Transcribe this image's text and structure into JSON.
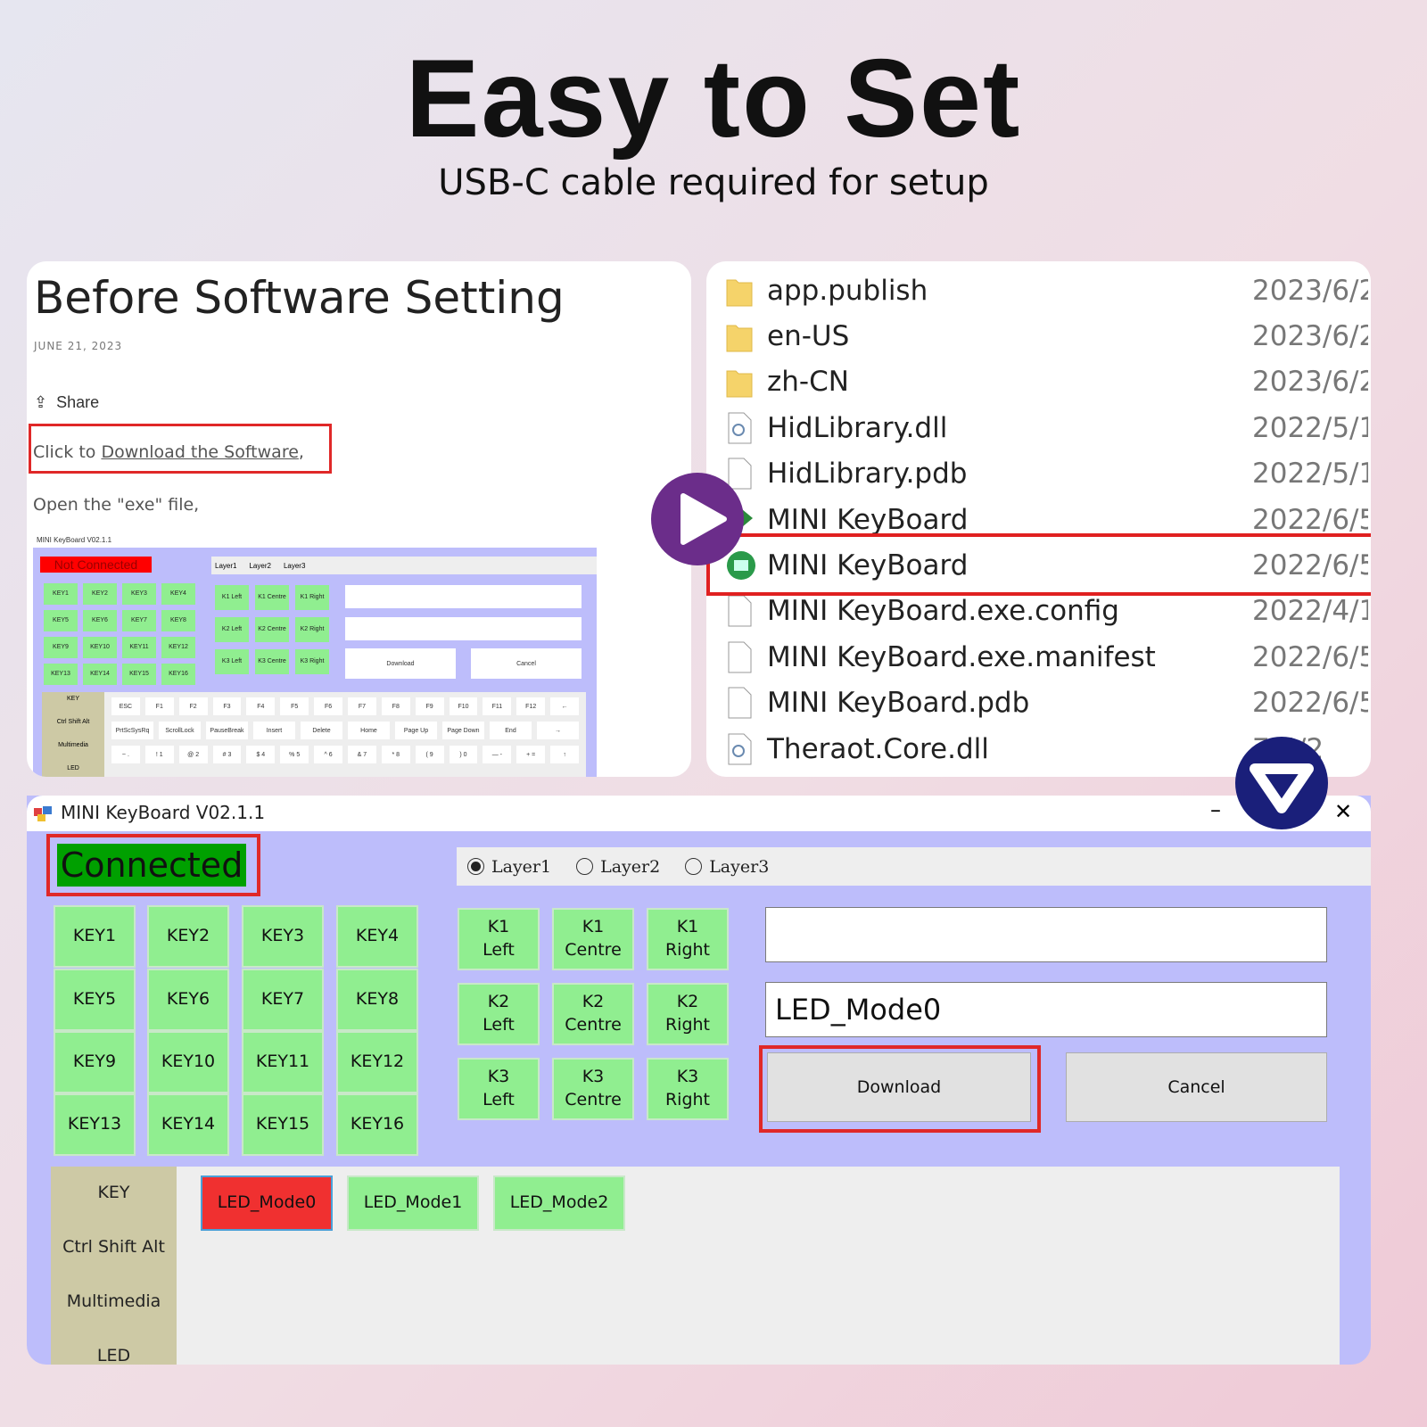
{
  "header": {
    "title": "Easy to Set",
    "subtitle": "USB-C cable required for setup"
  },
  "blog": {
    "title": "Before Software Setting",
    "date": "JUNE 21, 2023",
    "share": "Share",
    "click_to": "Click to ",
    "download_link": "Download the Software",
    "comma": ",",
    "open_exe": "Open the \"exe\" file,"
  },
  "mini_app": {
    "title": "MINI KeyBoard V02.1.1",
    "status": "Not Connected",
    "layers": [
      "Layer1",
      "Layer2",
      "Layer3"
    ],
    "keys": [
      "KEY1",
      "KEY2",
      "KEY3",
      "KEY4",
      "KEY5",
      "KEY6",
      "KEY7",
      "KEY8",
      "KEY9",
      "KEY10",
      "KEY11",
      "KEY12",
      "KEY13",
      "KEY14",
      "KEY15",
      "KEY16"
    ],
    "knobs": [
      "K1 Left",
      "K1 Centre",
      "K1 Right",
      "K2 Left",
      "K2 Centre",
      "K2 Right",
      "K3 Left",
      "K3 Centre",
      "K3 Right"
    ],
    "download": "Download",
    "cancel": "Cancel",
    "categories": [
      "KEY",
      "Ctrl Shift Alt",
      "Multimedia",
      "LED"
    ],
    "row1": [
      "ESC",
      "F1",
      "F2",
      "F3",
      "F4",
      "F5",
      "F6",
      "F7",
      "F8",
      "F9",
      "F10",
      "F11",
      "F12",
      "←"
    ],
    "row2": [
      "PrtScSysRq",
      "ScrollLock",
      "PauseBreak",
      "Insert",
      "Delete",
      "Home",
      "Page Up",
      "Page Down",
      "End",
      "→"
    ],
    "row3": [
      "~ .",
      "! 1",
      "@ 2",
      "# 3",
      "$ 4",
      "% 5",
      "^ 6",
      "& 7",
      "* 8",
      "( 9",
      ") 0",
      "— -",
      "+ =",
      "↑"
    ]
  },
  "files": [
    {
      "name": "app.publish",
      "date": "2023/6/2",
      "icon": "folder-icon"
    },
    {
      "name": "en-US",
      "date": "2023/6/2",
      "icon": "folder-icon"
    },
    {
      "name": "zh-CN",
      "date": "2023/6/2",
      "icon": "folder-icon"
    },
    {
      "name": "HidLibrary.dll",
      "date": "2022/5/1",
      "icon": "dll-icon"
    },
    {
      "name": "HidLibrary.pdb",
      "date": "2022/5/1",
      "icon": "file-icon"
    },
    {
      "name": "MINI KeyBoard",
      "date": "2022/6/5",
      "icon": "shortcut-icon"
    },
    {
      "name": "MINI KeyBoard",
      "date": "2022/6/5",
      "icon": "app-icon",
      "highlighted": true
    },
    {
      "name": "MINI KeyBoard.exe.config",
      "date": "2022/4/1",
      "icon": "file-icon"
    },
    {
      "name": "MINI KeyBoard.exe.manifest",
      "date": "2022/6/5",
      "icon": "file-icon"
    },
    {
      "name": "MINI KeyBoard.pdb",
      "date": "2022/6/5",
      "icon": "file-icon"
    },
    {
      "name": "Theraot.Core.dll",
      "date": "7/4/2",
      "icon": "dll-icon"
    }
  ],
  "app": {
    "title": "MINI KeyBoard V02.1.1",
    "minimize": "–",
    "close": "✕",
    "status": "Connected",
    "layers": [
      "Layer1",
      "Layer2",
      "Layer3"
    ],
    "selected_layer": "Layer1",
    "keys": [
      "KEY1",
      "KEY2",
      "KEY3",
      "KEY4",
      "KEY5",
      "KEY6",
      "KEY7",
      "KEY8",
      "KEY9",
      "KEY10",
      "KEY11",
      "KEY12",
      "KEY13",
      "KEY14",
      "KEY15",
      "KEY16"
    ],
    "knobs": [
      [
        "K1",
        "Left"
      ],
      [
        "K1",
        "Centre"
      ],
      [
        "K1",
        "Right"
      ],
      [
        "K2",
        "Left"
      ],
      [
        "K2",
        "Centre"
      ],
      [
        "K2",
        "Right"
      ],
      [
        "K3",
        "Left"
      ],
      [
        "K3",
        "Centre"
      ],
      [
        "K3",
        "Right"
      ]
    ],
    "input1": "",
    "input2": "LED_Mode0",
    "download": "Download",
    "cancel": "Cancel",
    "categories": [
      "KEY",
      "Ctrl Shift Alt",
      "Multimedia",
      "LED"
    ],
    "led_modes": [
      "LED_Mode0",
      "LED_Mode1",
      "LED_Mode2"
    ],
    "selected_led": "LED_Mode0"
  },
  "colors": {
    "key_green": "#90ee90",
    "connected_green": "#00a000",
    "highlight_red": "#e02828",
    "app_bg": "#bdbdfb",
    "play_purple": "#6b2d8a",
    "arrow_navy": "#1a1f7a"
  }
}
